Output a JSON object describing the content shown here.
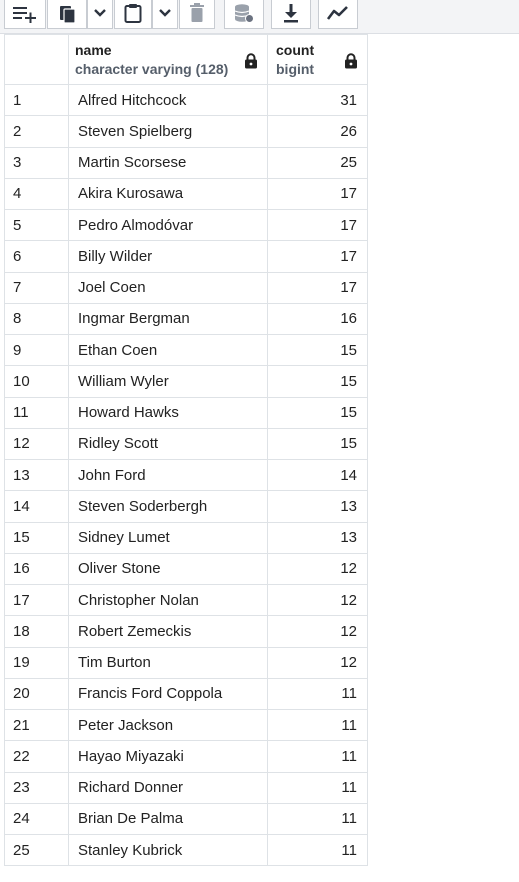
{
  "toolbar": {
    "buttons": [
      {
        "name": "add-row-button",
        "icon": "add-row-icon"
      },
      {
        "name": "copy-button",
        "icon": "copy-icon"
      },
      {
        "name": "copy-options-dropdown",
        "icon": "chevron-down-icon"
      },
      {
        "name": "paste-button",
        "icon": "paste-icon"
      },
      {
        "name": "paste-options-dropdown",
        "icon": "chevron-down-icon"
      },
      {
        "name": "delete-button",
        "icon": "trash-icon"
      },
      {
        "name": "save-data-button",
        "icon": "database-save-icon"
      },
      {
        "name": "download-button",
        "icon": "download-icon"
      },
      {
        "name": "graph-visualiser-button",
        "icon": "line-chart-icon"
      }
    ]
  },
  "grid": {
    "columns": [
      {
        "name": "name",
        "type": "character varying (128)"
      },
      {
        "name": "count",
        "type": "bigint"
      }
    ],
    "rows": [
      {
        "n": "1",
        "name": "Alfred Hitchcock",
        "count": "31"
      },
      {
        "n": "2",
        "name": "Steven Spielberg",
        "count": "26"
      },
      {
        "n": "3",
        "name": "Martin Scorsese",
        "count": "25"
      },
      {
        "n": "4",
        "name": "Akira Kurosawa",
        "count": "17"
      },
      {
        "n": "5",
        "name": "Pedro Almodóvar",
        "count": "17"
      },
      {
        "n": "6",
        "name": "Billy Wilder",
        "count": "17"
      },
      {
        "n": "7",
        "name": "Joel Coen",
        "count": "17"
      },
      {
        "n": "8",
        "name": "Ingmar Bergman",
        "count": "16"
      },
      {
        "n": "9",
        "name": "Ethan Coen",
        "count": "15"
      },
      {
        "n": "10",
        "name": "William Wyler",
        "count": "15"
      },
      {
        "n": "11",
        "name": "Howard Hawks",
        "count": "15"
      },
      {
        "n": "12",
        "name": "Ridley Scott",
        "count": "15"
      },
      {
        "n": "13",
        "name": "John Ford",
        "count": "14"
      },
      {
        "n": "14",
        "name": "Steven Soderbergh",
        "count": "13"
      },
      {
        "n": "15",
        "name": "Sidney Lumet",
        "count": "13"
      },
      {
        "n": "16",
        "name": "Oliver Stone",
        "count": "12"
      },
      {
        "n": "17",
        "name": "Christopher Nolan",
        "count": "12"
      },
      {
        "n": "18",
        "name": "Robert Zemeckis",
        "count": "12"
      },
      {
        "n": "19",
        "name": "Tim Burton",
        "count": "12"
      },
      {
        "n": "20",
        "name": "Francis Ford Coppola",
        "count": "11"
      },
      {
        "n": "21",
        "name": "Peter Jackson",
        "count": "11"
      },
      {
        "n": "22",
        "name": "Hayao Miyazaki",
        "count": "11"
      },
      {
        "n": "23",
        "name": "Richard Donner",
        "count": "11"
      },
      {
        "n": "24",
        "name": "Brian De Palma",
        "count": "11"
      },
      {
        "n": "25",
        "name": "Stanley Kubrick",
        "count": "11"
      }
    ]
  }
}
